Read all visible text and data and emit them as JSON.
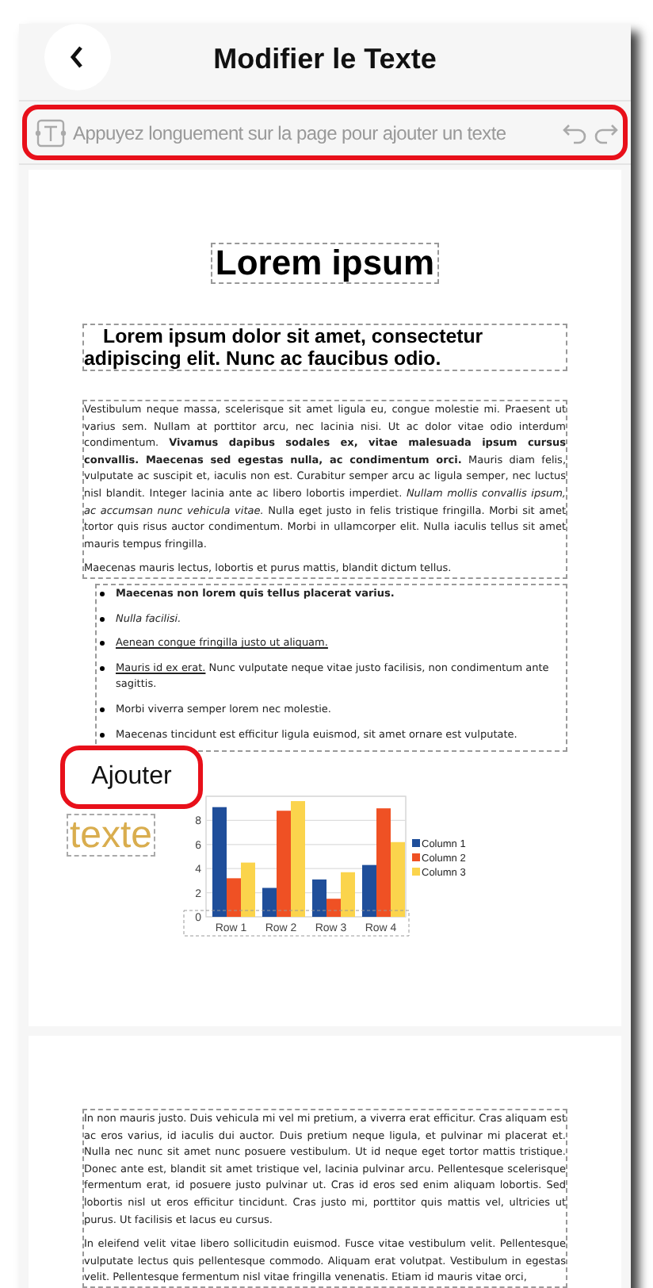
{
  "header": {
    "title": "Modifier le Texte"
  },
  "hint_bar": {
    "placeholder": "Appuyez longuement sur la page pour ajouter un texte",
    "highlighted": true
  },
  "page_1": {
    "title": "Lorem ipsum",
    "subtitle": "Lorem ipsum dolor sit amet, consectetur adipiscing elit. Nunc ac faucibus odio.",
    "paragraphs": [
      "Vestibulum neque massa, scelerisque sit amet ligula eu, congue molestie mi. Praesent ut varius sem. Nullam at porttitor arcu, nec lacinia nisi. Ut ac dolor vitae odio interdum condimentum. **Vivamus dapibus sodales ex, vitae malesuada ipsum cursus convallis. Maecenas sed egestas nulla, ac condimentum orci.** Mauris diam felis, vulputate ac suscipit et, iaculis non est. Curabitur semper arcu ac ligula semper, nec luctus nisl blandit. Integer lacinia ante ac libero lobortis imperdiet. *Nullam mollis convallis ipsum, ac accumsan nunc vehicula vitae.* Nulla eget justo in felis tristique fringilla. Morbi sit amet tortor quis risus auctor condimentum. Morbi in ullamcorper elit. Nulla iaculis tellus sit amet mauris tempus fringilla.",
      "Maecenas mauris lectus, lobortis et purus mattis, blandit dictum tellus."
    ],
    "list": [
      {
        "kind": "bold",
        "text": "Maecenas non lorem quis tellus placerat varius."
      },
      {
        "kind": "italic",
        "text": "Nulla facilisi."
      },
      {
        "kind": "underlined",
        "text": "Aenean congue fringilla justo ut aliquam."
      },
      {
        "kind": "plain",
        "lead": "Mauris id ex erat.",
        "text": "Nunc vulputate neque vitae justo facilisis, non condimentum ante sagittis."
      },
      {
        "kind": "plain",
        "text": "Morbi viverra semper lorem nec molestie."
      },
      {
        "kind": "plain",
        "text": "Maecenas tincidunt est efficitur ligula euismod, sit amet ornare est vulputate."
      }
    ],
    "chart_data": {
      "type": "bar",
      "grid": true,
      "legend": true,
      "categories": [
        "Row 1",
        "Row 2",
        "Row 3",
        "Row 4"
      ],
      "ylim": [
        0,
        10
      ],
      "yticks": [
        0,
        2,
        4,
        6,
        8
      ],
      "series": [
        {
          "name": "Column 1",
          "color": "#1f4e9a",
          "values": [
            9.1,
            2.4,
            3.1,
            4.3
          ]
        },
        {
          "name": "Column 2",
          "color": "#ef5124",
          "values": [
            3.2,
            8.8,
            1.5,
            9.0
          ]
        },
        {
          "name": "Column 3",
          "color": "#fbd44c",
          "values": [
            4.5,
            9.6,
            3.7,
            6.2
          ]
        }
      ]
    }
  },
  "popup": {
    "label": "Ajouter",
    "highlighted": true
  },
  "added_text": {
    "text": "texte"
  },
  "page_2": {
    "paragraphs": [
      "In non mauris justo. Duis vehicula mi vel mi pretium, a viverra erat efficitur. Cras aliquam est ac eros varius, id iaculis dui auctor. Duis pretium neque ligula, et pulvinar mi placerat et. Nulla nec nunc sit amet nunc posuere vestibulum. Ut id neque eget tortor mattis tristique. Donec ante est, blandit sit amet tristique vel, lacinia pulvinar arcu. Pellentesque scelerisque fermentum erat, id posuere justo pulvinar ut. Cras id eros sed enim aliquam lobortis. Sed lobortis nisl ut eros efficitur tincidunt. Cras justo mi, porttitor quis mattis vel, ultricies ut purus. Ut facilisis et lacus eu cursus.",
      "In eleifend velit vitae libero sollicitudin euismod. Fusce vitae vestibulum velit. Pellentesque vulputate lectus quis pellentesque commodo. Aliquam erat volutpat. Vestibulum in egestas velit. Pellentesque fermentum nisl vitae fringilla venenatis. Etiam id mauris vitae orci,"
    ]
  }
}
